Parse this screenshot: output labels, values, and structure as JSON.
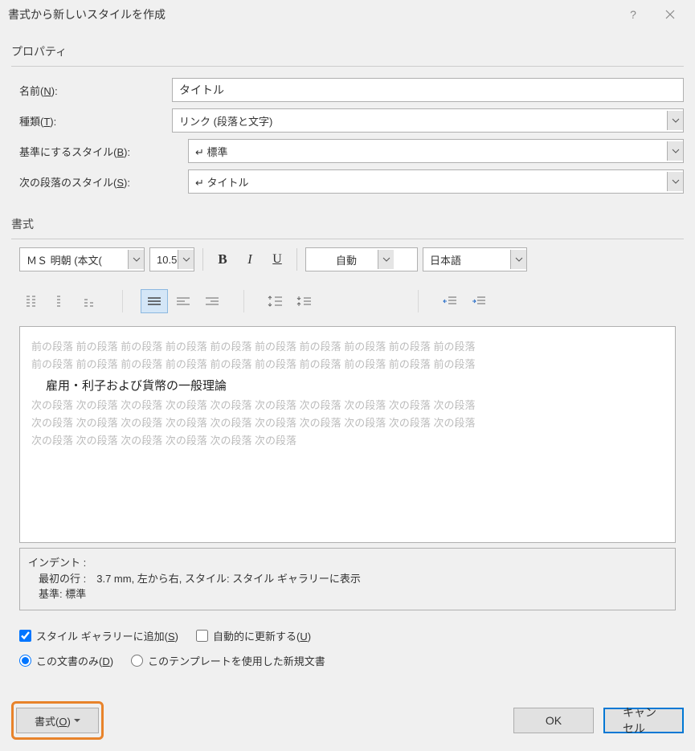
{
  "titlebar": {
    "title": "書式から新しいスタイルを作成"
  },
  "properties": {
    "legend": "プロパティ",
    "name_label": "名前(N):",
    "name_value": "タイトル",
    "type_label": "種類(T):",
    "type_value": "リンク (段落と文字)",
    "based_label": "基準にするスタイル(B):",
    "based_value": "↵ 標準",
    "next_label": "次の段落のスタイル(S):",
    "next_value": "↵ タイトル"
  },
  "format": {
    "legend": "書式",
    "font": "ＭＳ 明朝 (本文(",
    "size": "10.5",
    "color": "自動",
    "lang": "日本語"
  },
  "preview": {
    "before": "前の段落 前の段落 前の段落 前の段落 前の段落 前の段落 前の段落 前の段落 前の段落 前の段落",
    "before2": "前の段落 前の段落 前の段落 前の段落 前の段落 前の段落 前の段落 前の段落 前の段落 前の段落",
    "sample": "雇用・利子および貨幣の一般理論",
    "after1": "次の段落 次の段落 次の段落 次の段落 次の段落 次の段落 次の段落 次の段落 次の段落 次の段落",
    "after2": "次の段落 次の段落 次の段落 次の段落 次の段落 次の段落 次の段落 次の段落 次の段落 次の段落",
    "after3": "次の段落 次の段落 次の段落 次の段落 次の段落 次の段落"
  },
  "description": {
    "l1": "インデント :",
    "l2": "　最初の行 :　3.7 mm, 左から右, スタイル: スタイル ギャラリーに表示",
    "l3": "　基準: 標準"
  },
  "options": {
    "gallery": "スタイル ギャラリーに追加(S)",
    "auto": "自動的に更新する(U)",
    "thisdoc": "この文書のみ(D)",
    "template": "このテンプレートを使用した新規文書"
  },
  "buttons": {
    "format": "書式(O)",
    "ok": "OK",
    "cancel": "キャンセル"
  }
}
